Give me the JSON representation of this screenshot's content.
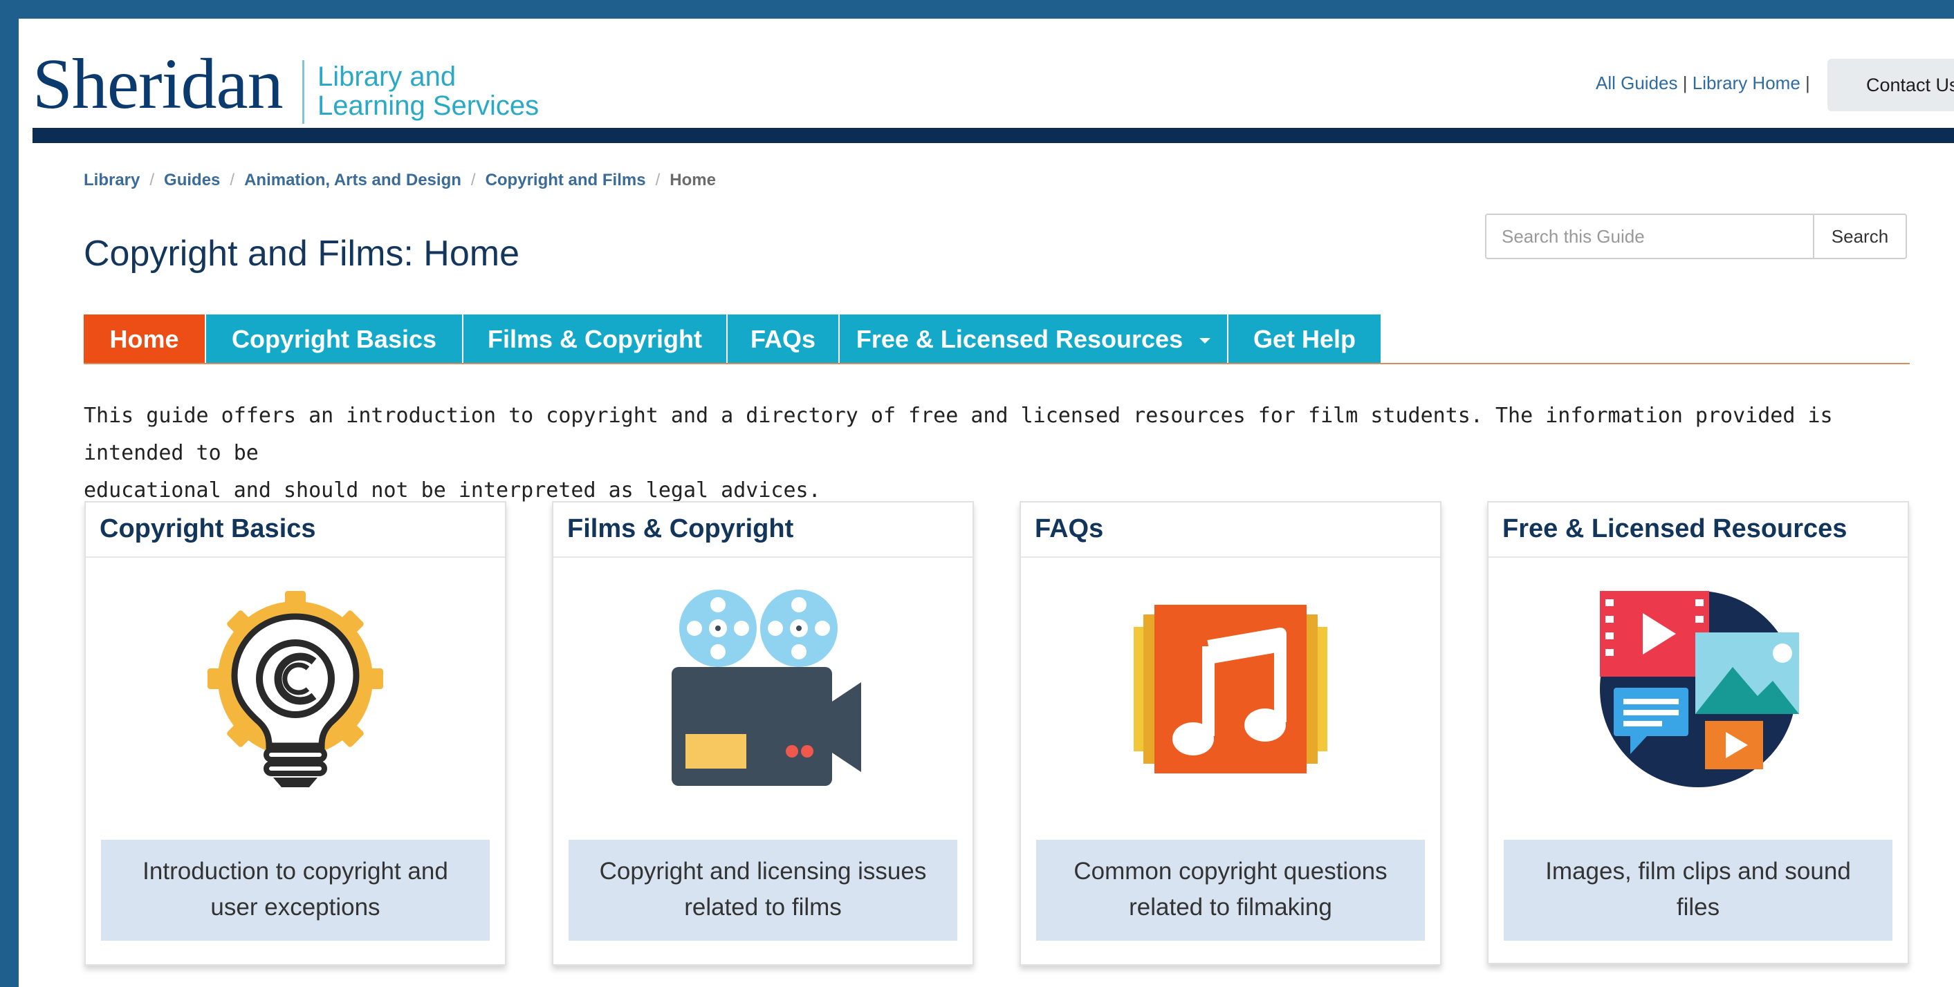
{
  "header": {
    "logo_word": "Sheridan",
    "logo_sub_line1": "Library and",
    "logo_sub_line2": "Learning Services",
    "links": [
      "All Guides",
      "Library Home"
    ],
    "link_separator": "|",
    "contact_label": "Contact Us"
  },
  "breadcrumb": {
    "items": [
      "Library",
      "Guides",
      "Animation, Arts and Design",
      "Copyright and Films"
    ],
    "current": "Home",
    "separator": "/"
  },
  "page_title": "Copyright and Films: Home",
  "search": {
    "placeholder": "Search this Guide",
    "button_label": "Search"
  },
  "tabs": [
    {
      "label": "Home",
      "active": true
    },
    {
      "label": "Copyright Basics",
      "active": false
    },
    {
      "label": "Films & Copyright",
      "active": false
    },
    {
      "label": "FAQs",
      "active": false
    },
    {
      "label": "Free & Licensed Resources",
      "active": false,
      "has_dropdown": true
    },
    {
      "label": "Get Help",
      "active": false
    }
  ],
  "intro_lines": [
    "This guide offers an introduction to copyright and a directory of free and licensed resources for film students. The information provided is intended to be",
    "educational and should not be interpreted as legal advices."
  ],
  "cards": [
    {
      "title": "Copyright Basics",
      "icon": "copyright-lightbulb-icon",
      "desc_lines": [
        "Introduction to copyright and",
        "user exceptions"
      ]
    },
    {
      "title": "Films & Copyright",
      "icon": "film-camera-icon",
      "desc_lines": [
        "Copyright and licensing issues",
        "related to films"
      ]
    },
    {
      "title": "FAQs",
      "icon": "music-album-icon",
      "desc_lines": [
        "Common copyright questions",
        "related to filmaking"
      ]
    },
    {
      "title": "Free & Licensed Resources",
      "icon": "media-files-icon",
      "desc_lines": [
        "Images, film clips and sound",
        "files"
      ]
    }
  ],
  "colors": {
    "brand_navy": "#0b2d55",
    "tab_teal": "#15a9c9",
    "tab_active_orange": "#ec4e16",
    "card_desc_bg": "#d7e3f0",
    "page_border_blue": "#1f5f8d"
  }
}
